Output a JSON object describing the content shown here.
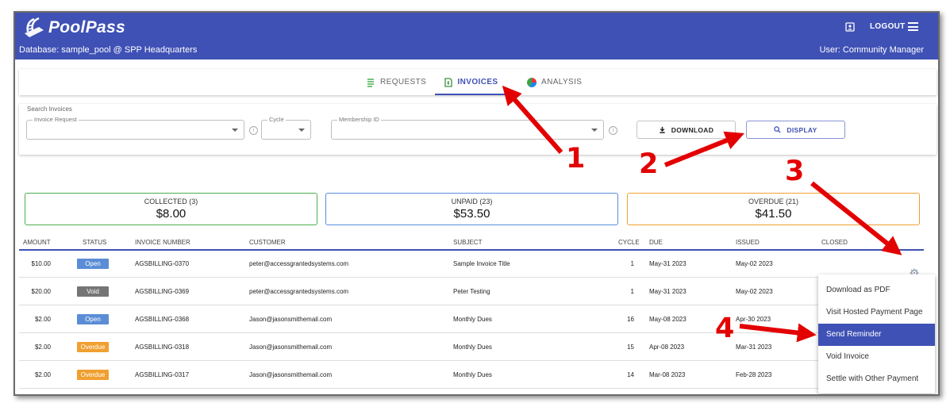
{
  "header": {
    "brand": "PoolPass",
    "database_line": "Database: sample_pool @ SPP Headquarters",
    "user_line": "User: Community Manager",
    "logout_label": "LOGOUT"
  },
  "tabs": [
    {
      "label": "REQUESTS",
      "icon": "list-icon"
    },
    {
      "label": "INVOICES",
      "icon": "invoice-doc-icon",
      "active": true
    },
    {
      "label": "ANALYSIS",
      "icon": "pie-chart-icon"
    }
  ],
  "search": {
    "title": "Search Invoices",
    "invoice_request_label": "Invoice Request",
    "cycle_label": "Cycle",
    "membership_id_label": "Membership ID",
    "download_label": "DOWNLOAD",
    "display_label": "DISPLAY"
  },
  "summary": [
    {
      "label": "COLLECTED (3)",
      "value": "$8.00",
      "color": "#4caf50"
    },
    {
      "label": "UNPAID (23)",
      "value": "$53.50",
      "color": "#5b8be0"
    },
    {
      "label": "OVERDUE (21)",
      "value": "$41.50",
      "color": "#f0a030"
    }
  ],
  "table": {
    "columns": [
      "AMOUNT",
      "STATUS",
      "INVOICE NUMBER",
      "CUSTOMER",
      "SUBJECT",
      "CYCLE",
      "DUE",
      "ISSUED",
      "CLOSED"
    ],
    "rows": [
      {
        "amount": "$10.00",
        "status": "Open",
        "invoice": "AGSBILLING-0370",
        "customer": "peter@accessgrantedsystems.com",
        "subject": "Sample Invoice Title",
        "cycle": "1",
        "due": "May-31 2023",
        "issued": "May-02 2023"
      },
      {
        "amount": "$20.00",
        "status": "Void",
        "invoice": "AGSBILLING-0369",
        "customer": "peter@accessgrantedsystems.com",
        "subject": "Peter Testing",
        "cycle": "1",
        "due": "May-31 2023",
        "issued": "May-02 2023"
      },
      {
        "amount": "$2.00",
        "status": "Open",
        "invoice": "AGSBILLING-0368",
        "customer": "Jason@jasonsmithemail.com",
        "subject": "Monthly Dues",
        "cycle": "16",
        "due": "May-08 2023",
        "issued": "Apr-30 2023"
      },
      {
        "amount": "$2.00",
        "status": "Overdue",
        "invoice": "AGSBILLING-0318",
        "customer": "Jason@jasonsmithemail.com",
        "subject": "Monthly Dues",
        "cycle": "15",
        "due": "Apr-08 2023",
        "issued": "Mar-31 2023"
      },
      {
        "amount": "$2.00",
        "status": "Overdue",
        "invoice": "AGSBILLING-0317",
        "customer": "Jason@jasonsmithemail.com",
        "subject": "Monthly Dues",
        "cycle": "14",
        "due": "Mar-08 2023",
        "issued": "Feb-28 2023"
      }
    ]
  },
  "status_colors": {
    "Open": "#5b8dd6",
    "Void": "#757575",
    "Overdue": "#f0a030"
  },
  "action_menu": [
    "Download as PDF",
    "Visit Hosted Payment Page",
    "Send Reminder",
    "Void Invoice",
    "Settle with Other Payment"
  ],
  "callouts": [
    "1",
    "2",
    "3",
    "4"
  ],
  "accent_color": "#3f51b5",
  "annotation_color": "#e30000"
}
